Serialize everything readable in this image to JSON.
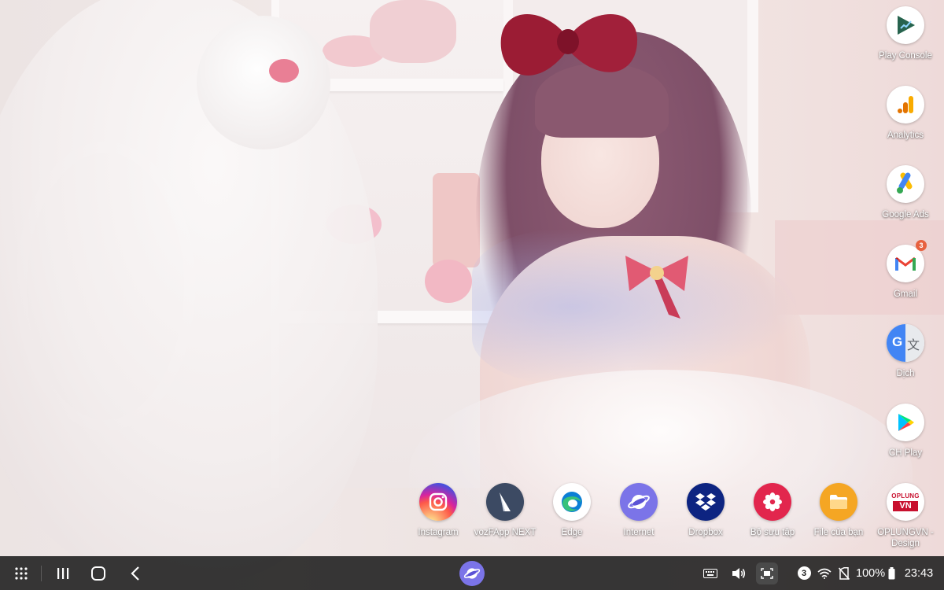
{
  "desktop": {
    "side_icons": [
      {
        "label": "Play Console",
        "icon": "play-console-icon"
      },
      {
        "label": "Analytics",
        "icon": "analytics-icon"
      },
      {
        "label": "Google Ads",
        "icon": "google-ads-icon"
      },
      {
        "label": "Gmail",
        "icon": "gmail-icon",
        "badge": "3"
      },
      {
        "label": "Dịch",
        "icon": "translate-icon",
        "glyph_left": "G",
        "glyph_right": "文"
      },
      {
        "label": "CH Play",
        "icon": "play-store-icon"
      }
    ],
    "bottom_icons": [
      {
        "label": "Instagram",
        "icon": "instagram-icon"
      },
      {
        "label": "vozFApp NEXT",
        "icon": "vozfapp-icon"
      },
      {
        "label": "Edge",
        "icon": "edge-icon"
      },
      {
        "label": "Internet",
        "icon": "internet-icon"
      },
      {
        "label": "Dropbox",
        "icon": "dropbox-icon"
      },
      {
        "label": "Bộ sưu tập",
        "icon": "gallery-icon"
      },
      {
        "label": "File của bạn",
        "icon": "my-files-icon"
      },
      {
        "label": "OPLUNGVN - Design",
        "icon": "oplungvn-icon",
        "logo_top": "OPLUNG",
        "logo_bottom": "VN"
      }
    ]
  },
  "taskbar": {
    "notification_count": "3",
    "battery_percent": "100%",
    "clock": "23:43",
    "pinned_app_icon": "internet-icon"
  },
  "colors": {
    "taskbar_bg": "#1c1c1c",
    "badge": "#e7613f",
    "label_text": "#ffffff"
  }
}
